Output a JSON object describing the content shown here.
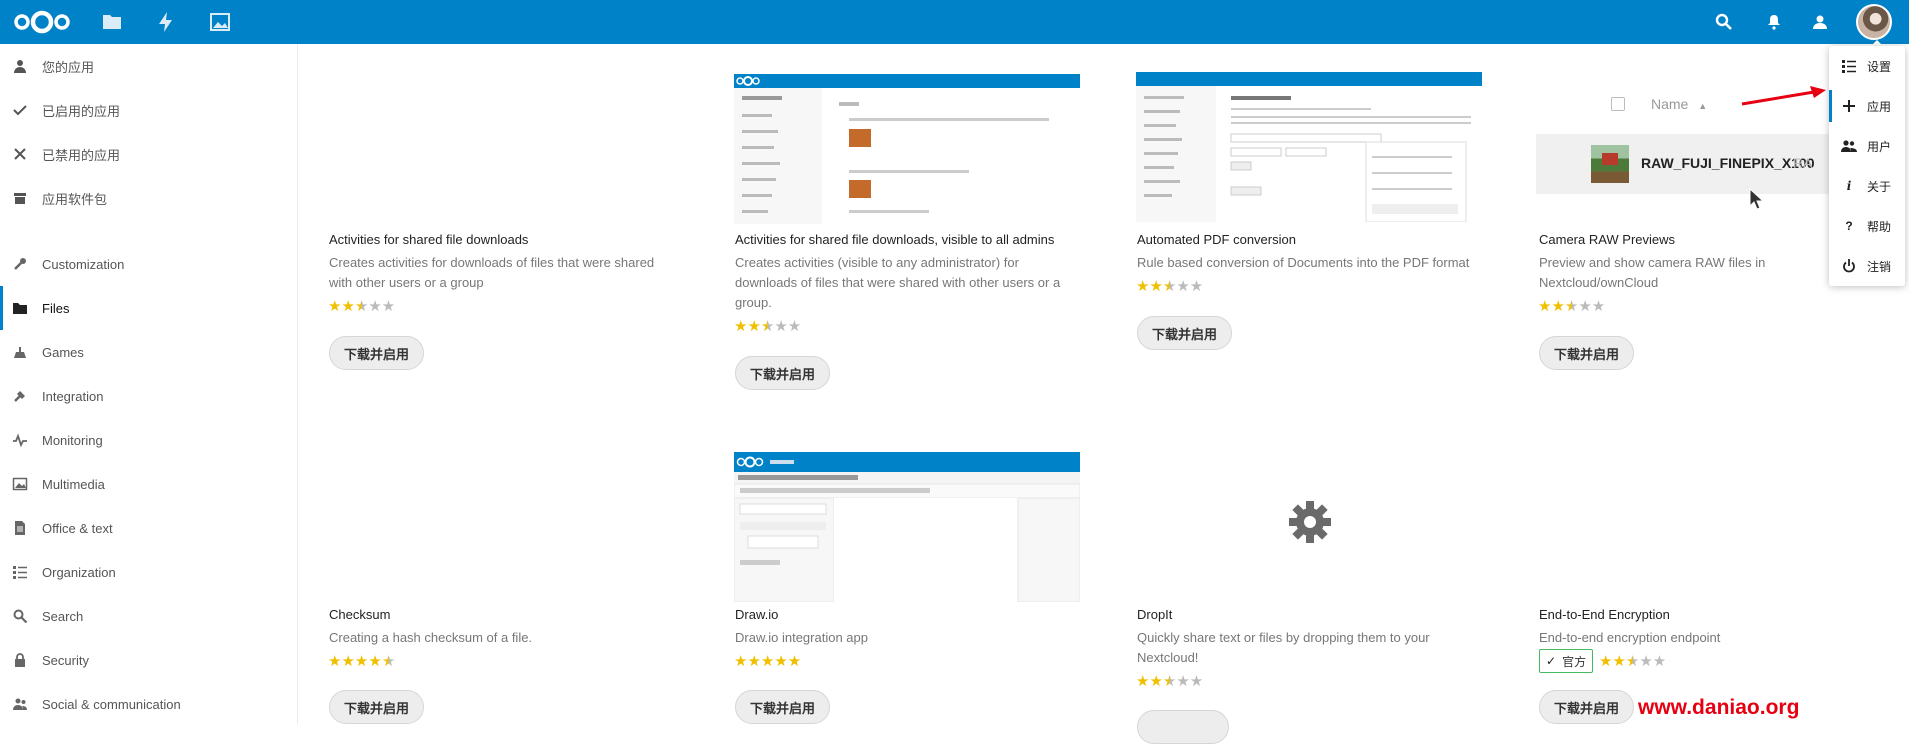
{
  "header": {
    "icons": [
      "nextcloud-logo",
      "files-icon",
      "activity-icon",
      "gallery-icon",
      "search-icon",
      "notifications-icon",
      "contacts-icon",
      "user-avatar"
    ]
  },
  "sidebar": {
    "top_items": [
      {
        "label": "您的应用",
        "icon": "user-icon"
      },
      {
        "label": "已启用的应用",
        "icon": "check-icon"
      },
      {
        "label": "已禁用的应用",
        "icon": "close-icon"
      },
      {
        "label": "应用软件包",
        "icon": "bundle-icon"
      }
    ],
    "categories": [
      {
        "label": "Customization",
        "icon": "wrench-icon"
      },
      {
        "label": "Files",
        "icon": "folder-icon",
        "active": true
      },
      {
        "label": "Games",
        "icon": "games-icon"
      },
      {
        "label": "Integration",
        "icon": "integration-icon"
      },
      {
        "label": "Monitoring",
        "icon": "monitoring-icon"
      },
      {
        "label": "Multimedia",
        "icon": "multimedia-icon"
      },
      {
        "label": "Office & text",
        "icon": "document-icon"
      },
      {
        "label": "Organization",
        "icon": "organization-icon"
      },
      {
        "label": "Search",
        "icon": "search-icon"
      },
      {
        "label": "Security",
        "icon": "lock-icon"
      },
      {
        "label": "Social & communication",
        "icon": "social-icon"
      }
    ]
  },
  "apps": [
    {
      "name": "Activities for shared file downloads",
      "desc": "Creates activities for downloads of files that were shared with other users or a group",
      "rating": 2.5,
      "button": "下载并启用"
    },
    {
      "name": "Activities for shared file downloads, visible to all admins",
      "desc": "Creates activities (visible to any administrator) for downloads of files that were shared with other users or a group.",
      "rating": 2.5,
      "button": "下载并启用"
    },
    {
      "name": "Automated PDF conversion",
      "desc": "Rule based conversion of Documents into the PDF format",
      "rating": 2.5,
      "button": "下载并启用"
    },
    {
      "name": "Camera RAW Previews",
      "desc": "Preview and show camera RAW files in Nextcloud/ownCloud",
      "rating": 2.5,
      "button": "下载并启用"
    },
    {
      "name": "Checksum",
      "desc": "Creating a hash checksum of a file.",
      "rating": 4.5,
      "button": "下载并启用"
    },
    {
      "name": "Draw.io",
      "desc": "Draw.io integration app",
      "rating": 5,
      "button": "下载并启用"
    },
    {
      "name": "DropIt",
      "desc": "Quickly share text or files by dropping them to your Nextcloud!",
      "rating": 2.5,
      "button": ""
    },
    {
      "name": "End-to-End Encryption",
      "desc": "End-to-end encryption endpoint",
      "rating": 2.5,
      "button": "下载并启用",
      "badge": "官方"
    }
  ],
  "camera_raw_preview": {
    "column_header": "Name",
    "file_name": "RAW_FUJI_FINEPIX_X100"
  },
  "user_menu": {
    "items": [
      {
        "label": "设置",
        "icon": "settings-icon"
      },
      {
        "label": "应用",
        "icon": "plus-icon",
        "active": true
      },
      {
        "label": "用户",
        "icon": "users-icon"
      },
      {
        "label": "关于",
        "icon": "info-icon"
      },
      {
        "label": "帮助",
        "icon": "help-icon"
      },
      {
        "label": "注销",
        "icon": "logout-icon"
      }
    ]
  },
  "watermark": "www.daniao.org",
  "colors": {
    "header": "#0082c9",
    "star": "#f0c000",
    "official": "#46ba61",
    "watermark": "#e60012"
  }
}
